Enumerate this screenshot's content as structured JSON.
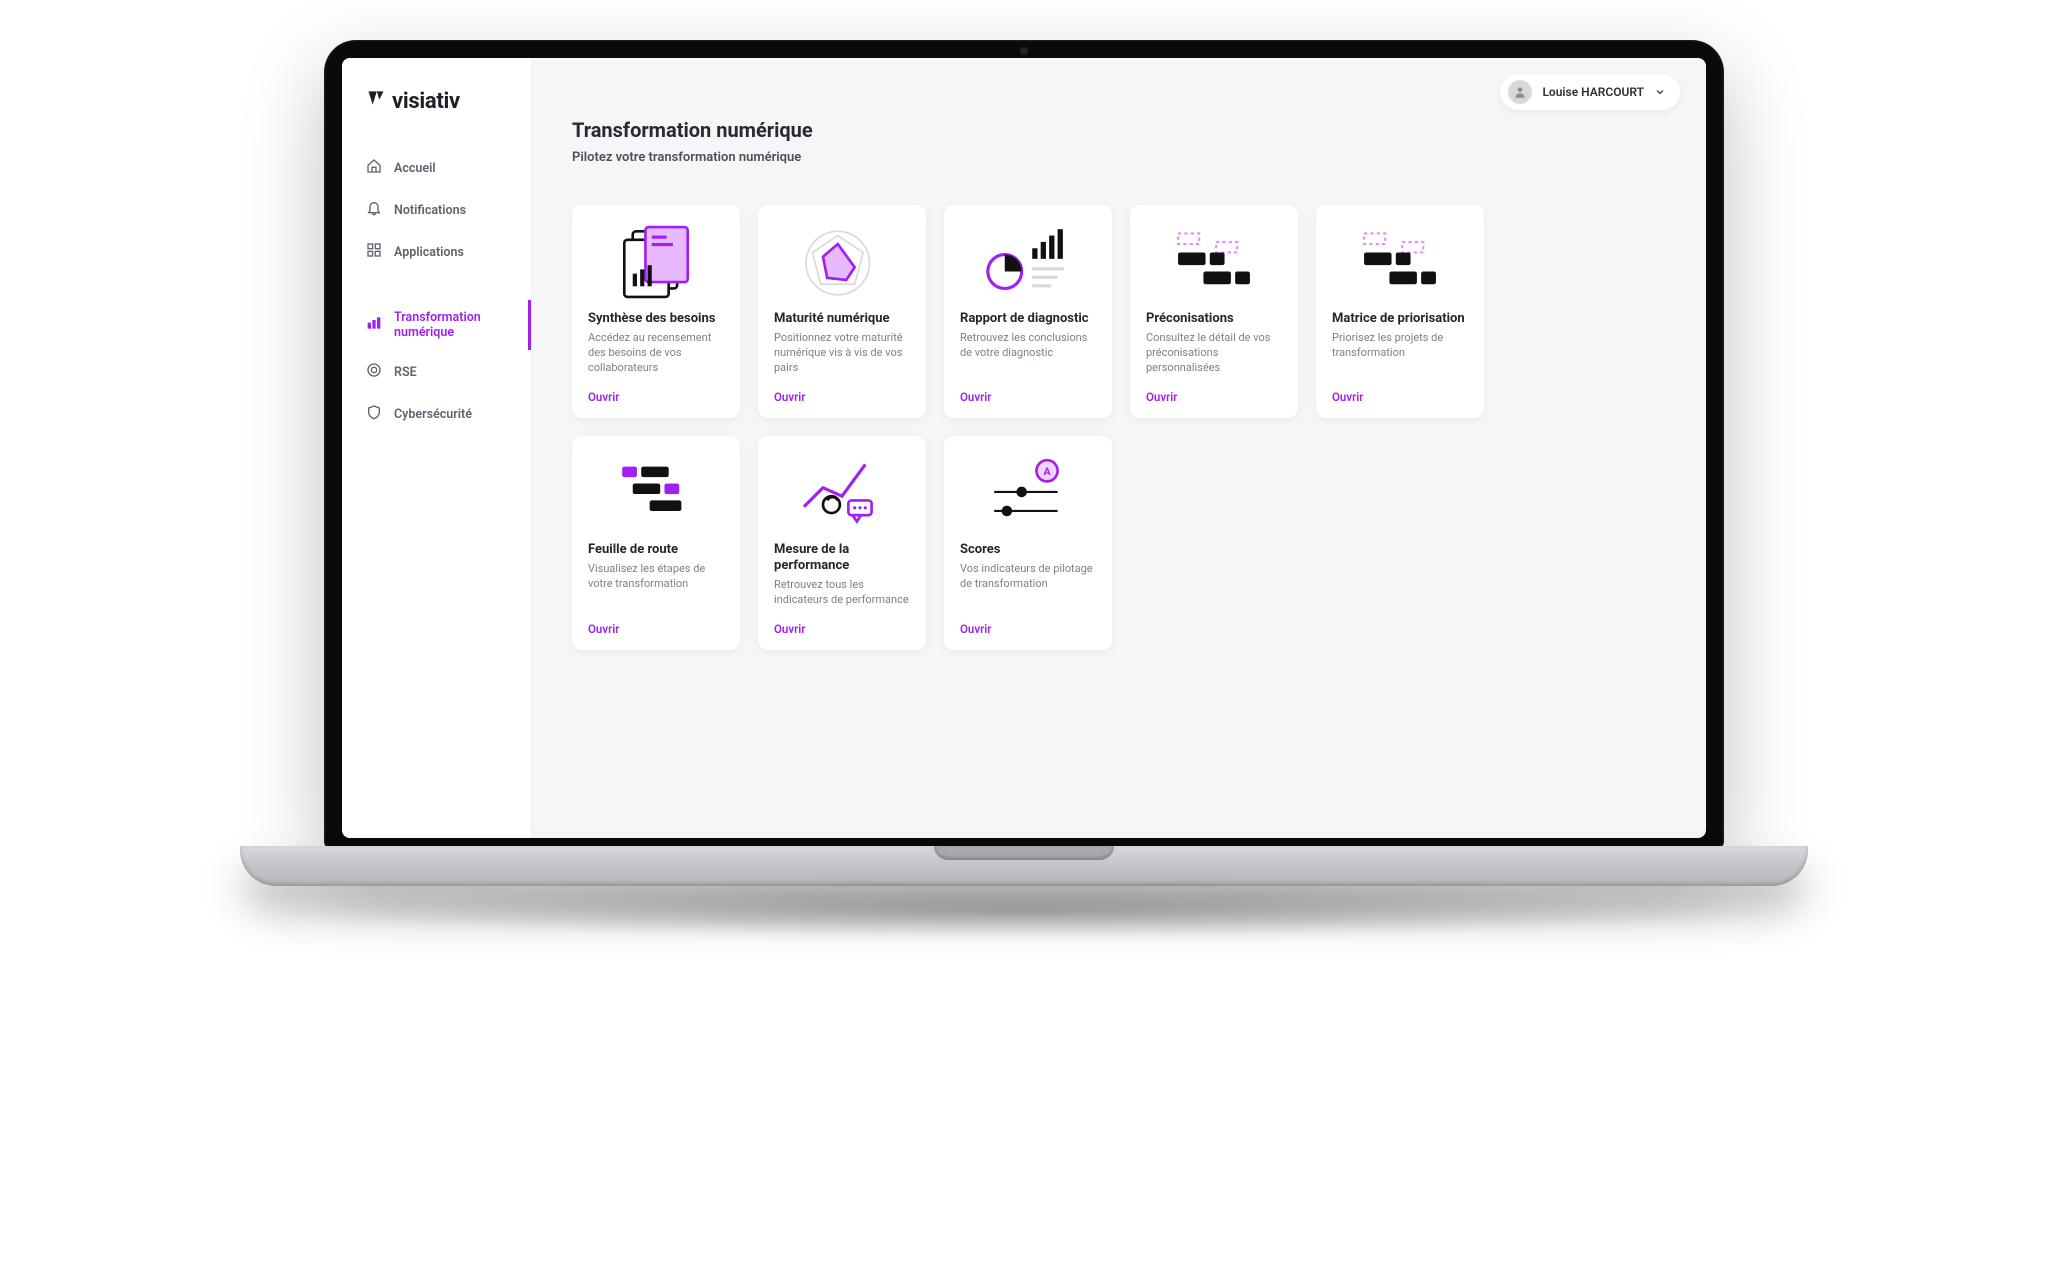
{
  "brand": "visiativ",
  "user": {
    "name": "Louise HARCOURT"
  },
  "sidebar": {
    "primary": [
      {
        "label": "Accueil",
        "icon": "home"
      },
      {
        "label": "Notifications",
        "icon": "bell"
      },
      {
        "label": "Applications",
        "icon": "apps"
      }
    ],
    "secondary": [
      {
        "label": "Transformation numérique",
        "icon": "bars",
        "active": true
      },
      {
        "label": "RSE",
        "icon": "target"
      },
      {
        "label": "Cybersécurité",
        "icon": "shield"
      }
    ]
  },
  "page": {
    "title": "Transformation numérique",
    "subtitle": "Pilotez votre transformation numérique"
  },
  "link_label": "Ouvrir",
  "cards": [
    {
      "title": "Synthèse des besoins",
      "desc": "Accédez au recensement des besoins de vos collaborateurs",
      "illus": "docs"
    },
    {
      "title": "Maturité numérique",
      "desc": "Positionnez votre maturité numérique vis à vis de vos pairs",
      "illus": "radar"
    },
    {
      "title": "Rapport de diagnostic",
      "desc": "Retrouvez les conclusions de votre diagnostic",
      "illus": "piebars"
    },
    {
      "title": "Préconisations",
      "desc": "Consultez le détail de vos préconisations personnalisées",
      "illus": "kanban"
    },
    {
      "title": "Matrice de priorisation",
      "desc": "Priorisez les projets de transformation",
      "illus": "kanban"
    },
    {
      "title": "Feuille de route",
      "desc": "Visualisez les étapes de votre transformation",
      "illus": "gantt"
    },
    {
      "title": "Mesure de la performance",
      "desc": "Retrouvez tous les indicateurs de performance",
      "illus": "perf"
    },
    {
      "title": "Scores",
      "desc": "Vos indicateurs de pilotage de transformation",
      "illus": "scores"
    }
  ],
  "colors": {
    "accent": "#a020f0",
    "ink": "#1d2026",
    "muted": "#7b818b"
  }
}
